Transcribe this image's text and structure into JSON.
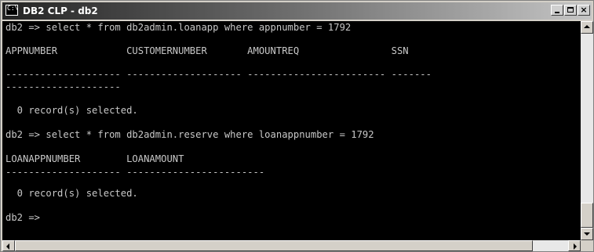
{
  "window": {
    "title": "DB2 CLP - db2",
    "icon": "console-icon",
    "icon_glyph": "C:\\",
    "controls": {
      "minimize": "minimize-icon",
      "maximize": "maximize-icon",
      "close": "×"
    }
  },
  "console": {
    "lines": [
      "db2 => select * from db2admin.loanapp where appnumber = 1792",
      "APPNUMBER            CUSTOMERNUMBER       AMOUNTREQ                SSN",
      "-------------------- -------------------- ------------------------ -------",
      "--------------------",
      "  0 record(s) selected.",
      "db2 => select * from db2admin.reserve where loanappnumber = 1792",
      "LOANAPPNUMBER        LOANAMOUNT",
      "-------------------- ------------------------",
      "  0 record(s) selected.",
      "db2 =>"
    ]
  }
}
